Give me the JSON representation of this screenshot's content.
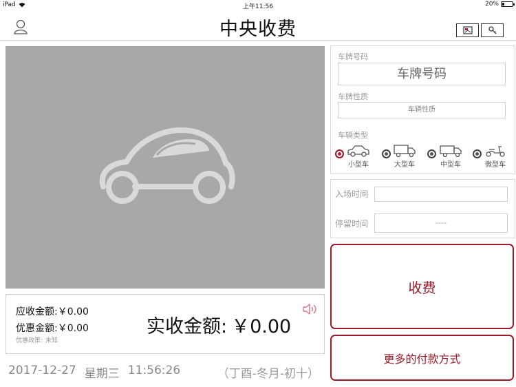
{
  "status_bar": {
    "device": "iPad",
    "time": "上午11:56",
    "battery": "20%",
    "battery_level": 0.2
  },
  "header": {
    "title": "中央收费"
  },
  "amounts": {
    "due_label": "应收金额:",
    "due_value": "￥0.00",
    "discount_label": "优惠金额:",
    "discount_value": "￥0.00",
    "policy_label": "优惠政策:",
    "policy_value": "未知",
    "actual_label": "实收金额:",
    "actual_value": "￥0.00"
  },
  "datetime": {
    "date": "2017-12-27",
    "weekday": "星期三",
    "time": "11:56:26",
    "lunar": "（丁酉-冬月-初十）"
  },
  "plate": {
    "number_label": "车牌号码",
    "number_placeholder": "车牌号码",
    "nature_label": "车牌性质",
    "nature_placeholder": "车辆性质",
    "type_label": "车辆类型",
    "types": [
      {
        "label": "小型车",
        "selected": true
      },
      {
        "label": "大型车",
        "selected": false
      },
      {
        "label": "中型车",
        "selected": false
      },
      {
        "label": "微型车",
        "selected": false
      }
    ]
  },
  "times": {
    "entry_label": "入场时间",
    "entry_value": "",
    "stay_label": "停留时间",
    "stay_value": "----"
  },
  "actions": {
    "charge": "收费",
    "more_payment": "更多的付款方式"
  },
  "colors": {
    "accent": "#9b1b2a",
    "camera_bg": "#a8a8a8"
  }
}
